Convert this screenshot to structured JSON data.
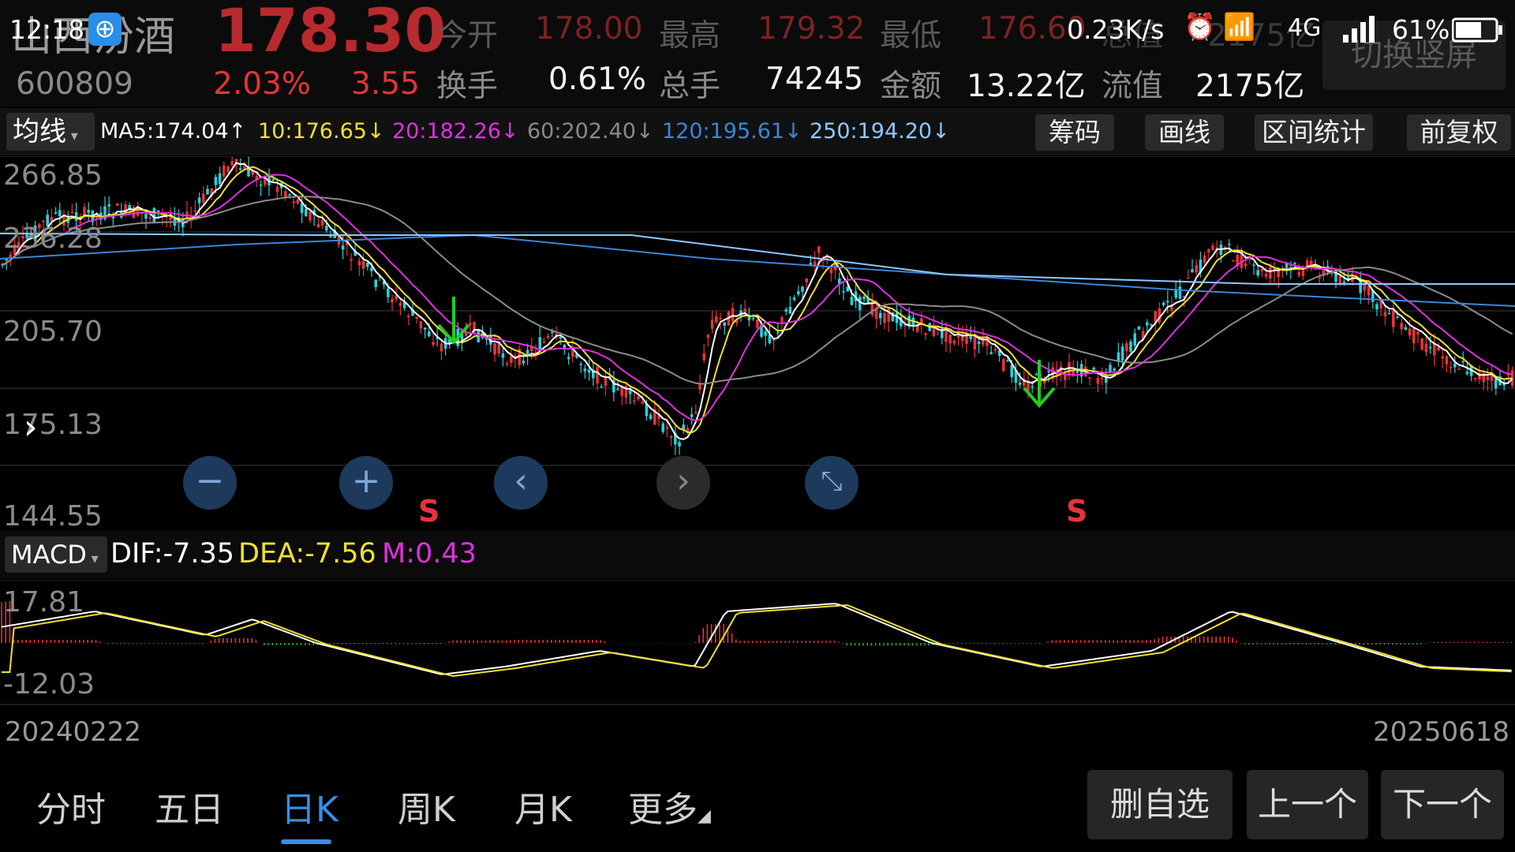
{
  "status_bar": {
    "time": "12:18",
    "speed": "0.23K/s",
    "network": "4G",
    "battery": "61%"
  },
  "quote": {
    "name": "山西汾酒",
    "code": "600809",
    "price": "178.30",
    "change_pct": "2.03%",
    "change": "3.55",
    "open_label": "今开",
    "open": "178.00",
    "high_label": "最高",
    "high": "179.32",
    "low_label": "最低",
    "low": "176.60",
    "mktcap_label": "总值",
    "mktcap": "2175亿",
    "turnover_label": "换手",
    "turnover": "0.61%",
    "volume_label": "总手",
    "volume": "74245",
    "amount_label": "金额",
    "amount": "13.22亿",
    "float_label": "流值",
    "float_value": "2175亿",
    "switch_button": "切换竖屏"
  },
  "indicators": {
    "selector": "均线",
    "ma5": "MA5:174.04↑",
    "ma10": "10:176.65↓",
    "ma20": "20:182.26↓",
    "ma60": "60:202.40↓",
    "ma120": "120:195.61↓",
    "ma250": "250:194.20↓"
  },
  "toolbar": {
    "chips": "筹码",
    "draw": "画线",
    "interval_stats": "区间统计",
    "adjust": "前复权"
  },
  "price_axis": [
    "266.85",
    "236.28",
    "205.70",
    "175.13",
    "144.55"
  ],
  "signals": [
    "S",
    "S"
  ],
  "macd": {
    "selector": "MACD",
    "dif": "DIF:-7.35",
    "dea": "DEA:-7.56",
    "m": "M:0.43",
    "axis_top": "17.81",
    "axis_bottom": "-12.03"
  },
  "date_range": {
    "start": "20240222",
    "end": "20250618"
  },
  "bottom_tabs": [
    "分时",
    "五日",
    "日K",
    "周K",
    "月K",
    "更多"
  ],
  "active_tab": "日K",
  "action_buttons": {
    "remove_watch": "删自选",
    "prev": "上一个",
    "next": "下一个"
  },
  "colors": {
    "up": "#e5333a",
    "down": "#2ad0d8",
    "ma5": "#ffffff",
    "ma10": "#f0e030",
    "ma20": "#e030e0",
    "ma60": "#8a8a8a",
    "ma120": "#3a86d8",
    "ma250": "#8ec8ff",
    "active_tab": "#3a8ee6"
  }
}
